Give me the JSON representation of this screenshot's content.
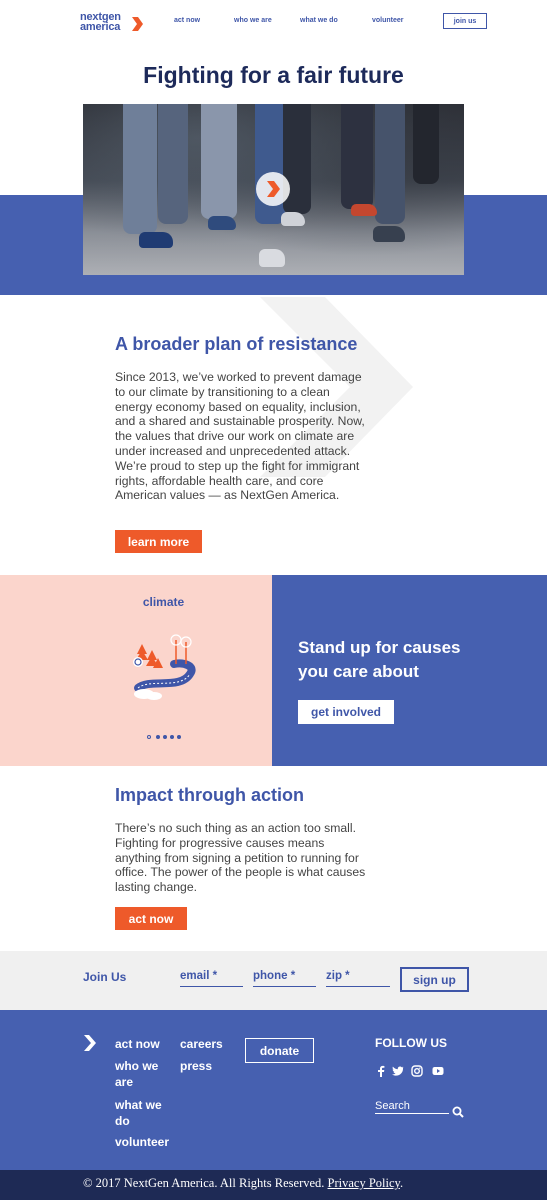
{
  "header": {
    "logo_line1": "nextgen",
    "logo_line2": "america",
    "nav": [
      "act now",
      "who we are",
      "what we do",
      "volunteer"
    ],
    "join_label": "join us"
  },
  "hero": {
    "title": "Fighting for a fair future"
  },
  "resistance": {
    "heading": "A broader plan of resistance",
    "body": "Since 2013, we’ve worked to prevent damage to our climate by transitioning to a clean energy economy based on equality, inclusion, and a shared and sustainable prosperity. Now, the values that drive our work on climate are under increased and unprecedented attack. We’re proud to step up the fight for immigrant rights, affordable health care, and core American values — as NextGen America.",
    "button": "learn more"
  },
  "causes": {
    "carousel_label": "climate",
    "heading_line1": "Stand up for causes",
    "heading_line2": "you care about",
    "button": "get involved"
  },
  "impact": {
    "heading": "Impact through action",
    "body": "There’s no such thing as an action too small. Fighting for progressive causes means anything from signing a petition to running for office. The power of the people is what causes lasting change.",
    "button": "act now"
  },
  "join_bar": {
    "label": "Join Us",
    "email_placeholder": "email *",
    "phone_placeholder": "phone *",
    "zip_placeholder": "zip *",
    "button": "sign up"
  },
  "footer": {
    "col1": [
      "act now",
      "who we are",
      "what we do",
      "volunteer"
    ],
    "col2": [
      "careers",
      "press"
    ],
    "donate": "donate",
    "follow": "FOLLOW US",
    "social_icons": [
      "facebook-icon",
      "twitter-icon",
      "instagram-icon",
      "youtube-icon"
    ],
    "search_placeholder": "Search"
  },
  "bottom": {
    "copyright": "© 2017 NextGen America. All Rights Reserved.",
    "privacy": "Privacy Policy",
    "period": "."
  },
  "colors": {
    "brand_blue": "#4660b0",
    "accent_orange": "#ee5a2a",
    "pink": "#fbd5cc",
    "navy": "#1e2a55"
  }
}
